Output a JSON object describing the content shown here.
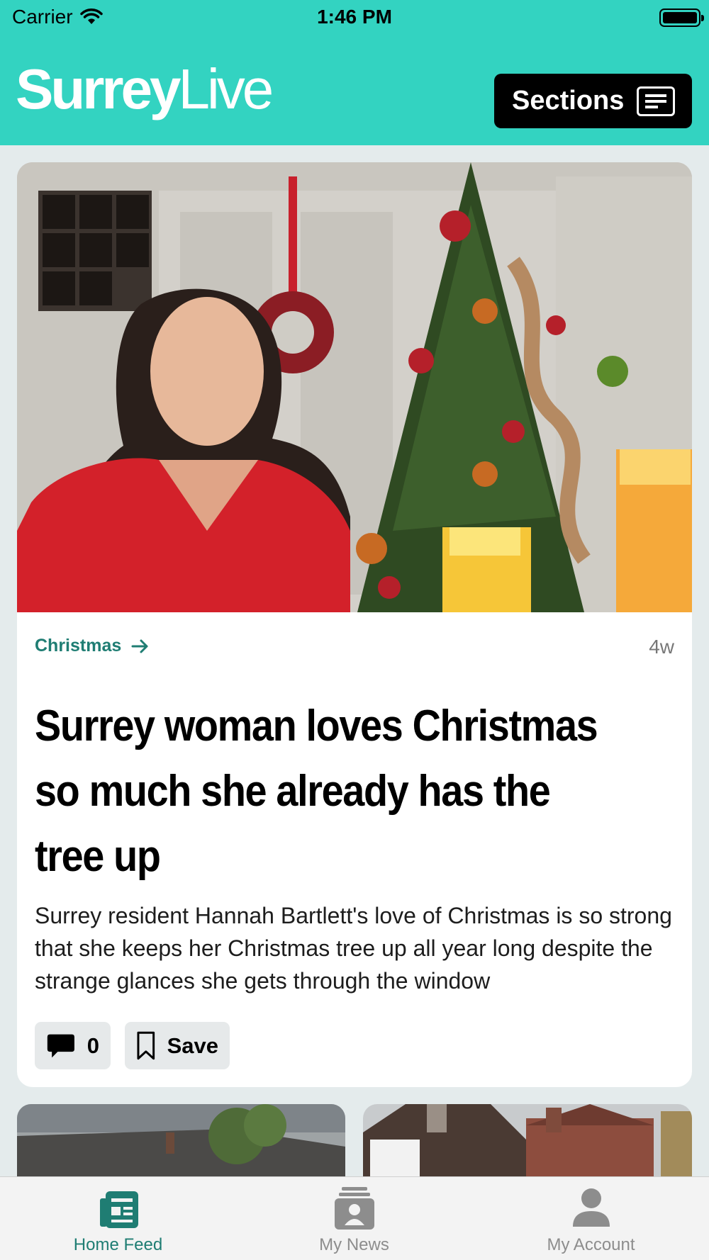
{
  "status": {
    "carrier": "Carrier",
    "time": "1:46 PM"
  },
  "header": {
    "logo_part1": "Surrey",
    "logo_part2": "Live",
    "sections_label": "Sections"
  },
  "article": {
    "category": "Christmas",
    "age": "4w",
    "headline": "Surrey woman loves Christmas so much she already has the tree up",
    "summary": "Surrey resident Hannah Bartlett's love of Christmas is so strong that she keeps her Christmas tree up all year long despite the strange glances she gets through the window",
    "comment_count": "0",
    "save_label": "Save"
  },
  "tabs": [
    {
      "label": "Home Feed",
      "icon": "home-feed-icon",
      "active": true
    },
    {
      "label": "My News",
      "icon": "my-news-icon",
      "active": false
    },
    {
      "label": "My Account",
      "icon": "account-icon",
      "active": false
    }
  ],
  "colors": {
    "brand": "#33d3c1",
    "accent": "#1f7d73",
    "inactive_tab": "#8d8d8d"
  }
}
